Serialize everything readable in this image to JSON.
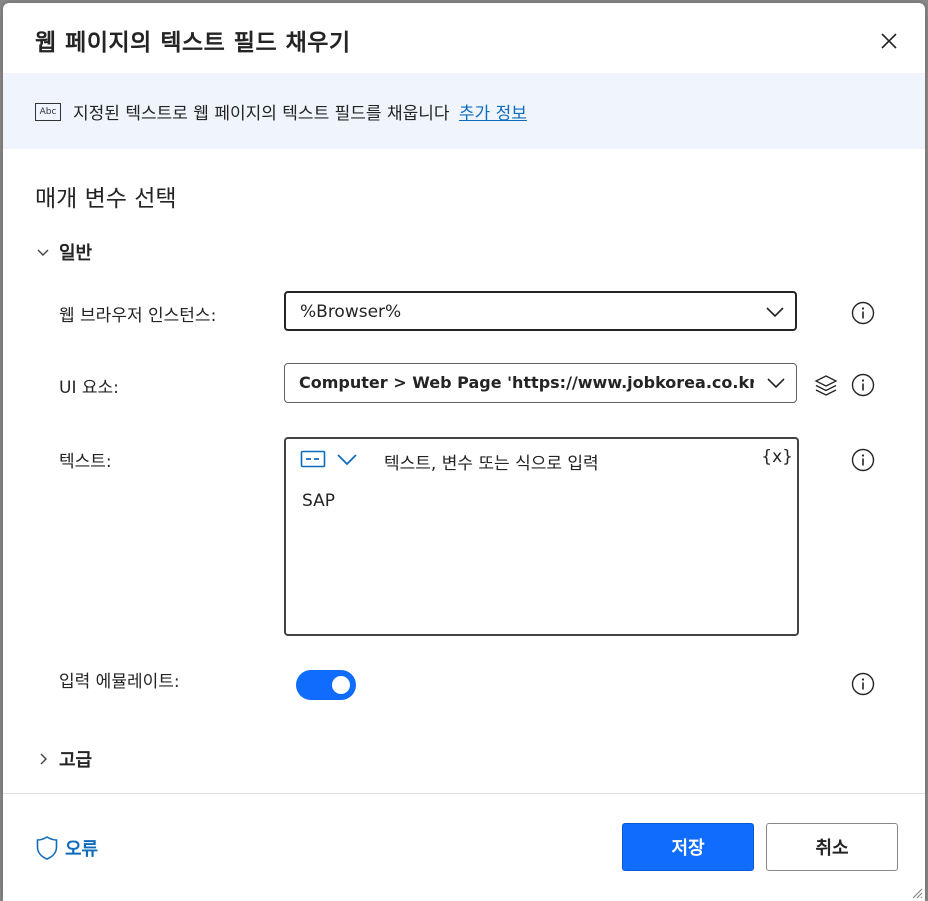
{
  "dialog": {
    "title": "웹 페이지의 텍스트 필드 채우기"
  },
  "banner": {
    "icon": "abc-text-icon",
    "icon_text": "Abc",
    "text": "지정된 텍스트로 웹 페이지의 텍스트 필드를 채웁니다",
    "link": "추가 정보"
  },
  "section_title": "매개 변수 선택",
  "general": {
    "label": "일반",
    "expanded": true,
    "fields": {
      "browser": {
        "label": "웹 브라우저 인스턴스:",
        "value": "%Browser%"
      },
      "ui_element": {
        "label": "UI 요소:",
        "value": "Computer > Web Page 'https://www.jobkorea.co.kr/' > <"
      },
      "text": {
        "label": "텍스트:",
        "placeholder": "텍스트, 변수 또는 식으로 입력",
        "var_button": "{x}",
        "value": "SAP"
      },
      "emulate": {
        "label": "입력 에뮬레이트:",
        "enabled": true
      }
    }
  },
  "advanced": {
    "label": "고급",
    "expanded": false
  },
  "footer": {
    "error_label": "오류",
    "save_label": "저장",
    "cancel_label": "취소"
  },
  "colors": {
    "accent": "#0f6cfd",
    "link": "#0f6cbd",
    "banner_bg": "#eff4fd"
  }
}
